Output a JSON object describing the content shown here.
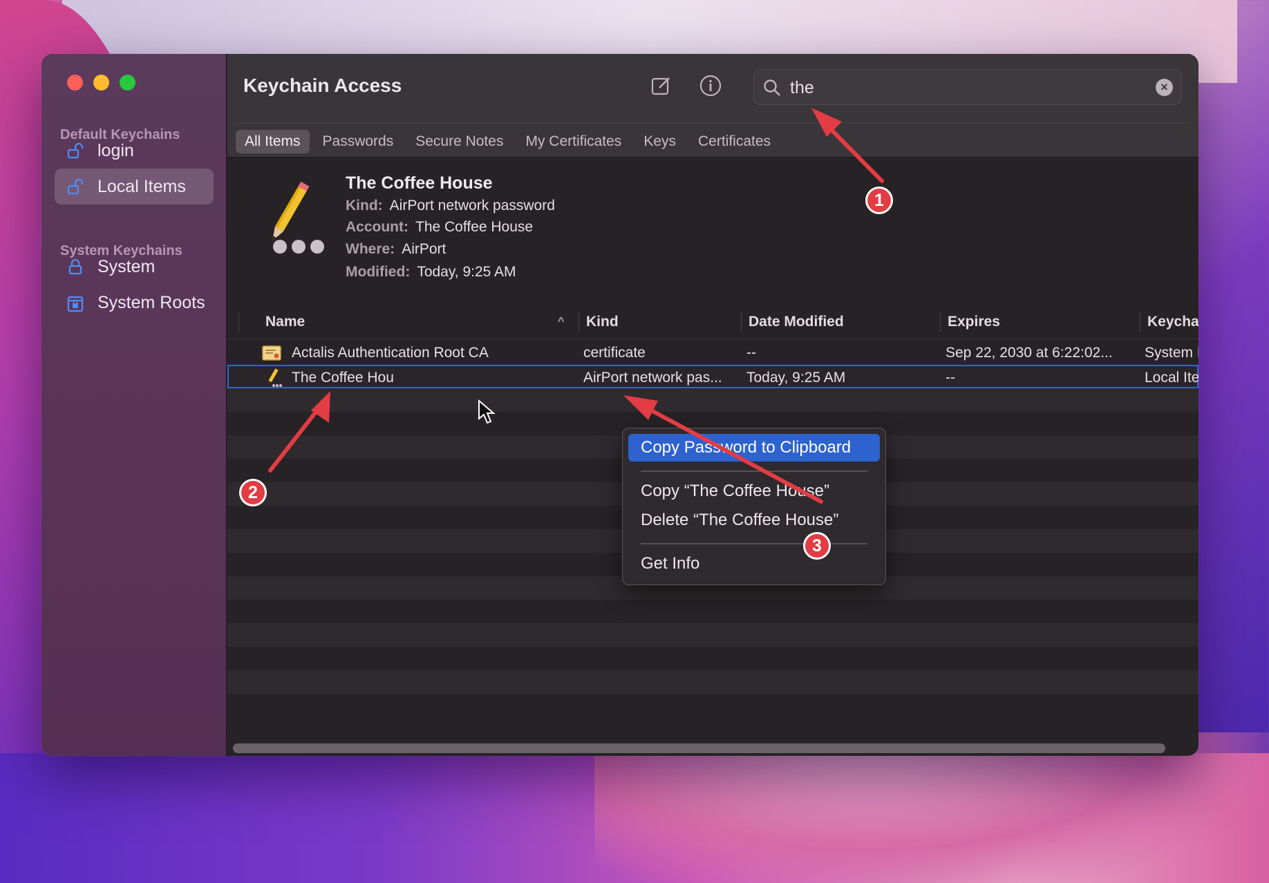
{
  "app": {
    "title": "Keychain Access"
  },
  "sidebar": {
    "default_section": "Default Keychains",
    "system_section": "System Keychains",
    "items": [
      {
        "label": "login",
        "icon": "unlock-icon"
      },
      {
        "label": "Local Items",
        "icon": "unlock-icon"
      },
      {
        "label": "System",
        "icon": "lock-icon"
      },
      {
        "label": "System Roots",
        "icon": "locked-cabinet-icon"
      }
    ]
  },
  "search": {
    "value": "the",
    "placeholder": "Search"
  },
  "tabs": [
    "All Items",
    "Passwords",
    "Secure Notes",
    "My Certificates",
    "Keys",
    "Certificates"
  ],
  "detail": {
    "title": "The Coffee House",
    "kind_label": "Kind:",
    "kind": "AirPort network password",
    "account_label": "Account:",
    "account": "The Coffee House",
    "where_label": "Where:",
    "where": "AirPort",
    "modified_label": "Modified:",
    "modified": "Today, 9:25 AM"
  },
  "columns": [
    "Name",
    "Kind",
    "Date Modified",
    "Expires",
    "Keychain"
  ],
  "rows": [
    {
      "name": "Actalis Authentication Root CA",
      "kind": "certificate",
      "date": "--",
      "expires": "Sep 22, 2030 at 6:22:02...",
      "keychain": "System Roots"
    },
    {
      "name": "The Coffee Hou",
      "kind": "AirPort network pas...",
      "date": "Today, 9:25 AM",
      "expires": "--",
      "keychain": "Local Items"
    }
  ],
  "context_menu": {
    "copy_password": "Copy Password to Clipboard",
    "copy_name": "Copy “The Coffee House”",
    "delete": "Delete “The Coffee House”",
    "get_info": "Get Info"
  },
  "annotations": [
    "1",
    "2",
    "3"
  ],
  "colors": {
    "accent": "#2d62cf",
    "annotation": "#e23c44"
  }
}
